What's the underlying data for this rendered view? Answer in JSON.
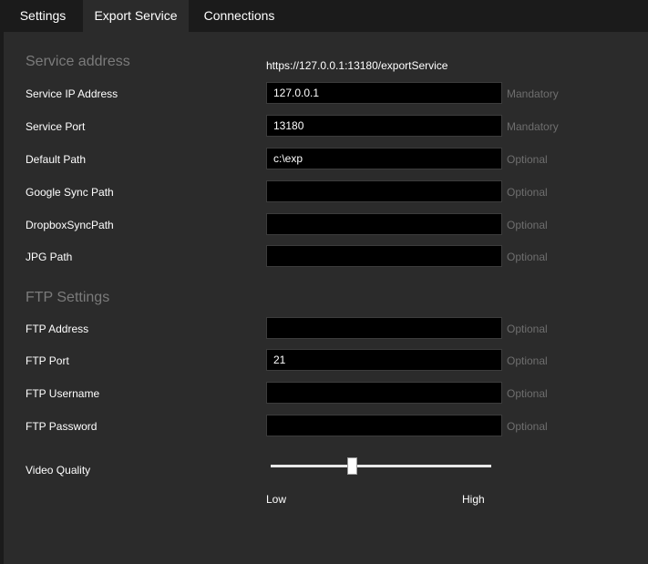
{
  "tabs": [
    "Settings",
    "Export Service",
    "Connections"
  ],
  "active_tab": "Export Service",
  "service_section": {
    "title": "Service address",
    "url": "https://127.0.0.1:13180/exportService"
  },
  "fields": {
    "service_ip": {
      "label": "Service IP Address",
      "value": "127.0.0.1",
      "hint": "Mandatory"
    },
    "service_port": {
      "label": "Service Port",
      "value": "13180",
      "hint": "Mandatory"
    },
    "default_path": {
      "label": "Default Path",
      "value": "c:\\exp",
      "hint": "Optional"
    },
    "google_sync": {
      "label": "Google Sync Path",
      "value": "",
      "hint": "Optional"
    },
    "dropbox_sync": {
      "label": "DropboxSyncPath",
      "value": "",
      "hint": "Optional"
    },
    "jpg_path": {
      "label": "JPG Path",
      "value": "",
      "hint": "Optional"
    },
    "ftp_address": {
      "label": "FTP Address",
      "value": "",
      "hint": "Optional"
    },
    "ftp_port": {
      "label": "FTP Port",
      "value": "21",
      "hint": "Optional"
    },
    "ftp_username": {
      "label": "FTP Username",
      "value": "",
      "hint": "Optional"
    },
    "ftp_password": {
      "label": "FTP Password",
      "value": "",
      "hint": "Optional"
    }
  },
  "ftp_section": {
    "title": "FTP Settings"
  },
  "video_quality": {
    "label": "Video Quality",
    "min_label": "Low",
    "max_label": "High",
    "value_fraction": 0.37
  },
  "colors": {
    "background": "#1b1b1b",
    "panel": "#2b2b2b",
    "field": "#000000",
    "hint": "#6e6e6e",
    "section_title": "#7b7b7b"
  }
}
